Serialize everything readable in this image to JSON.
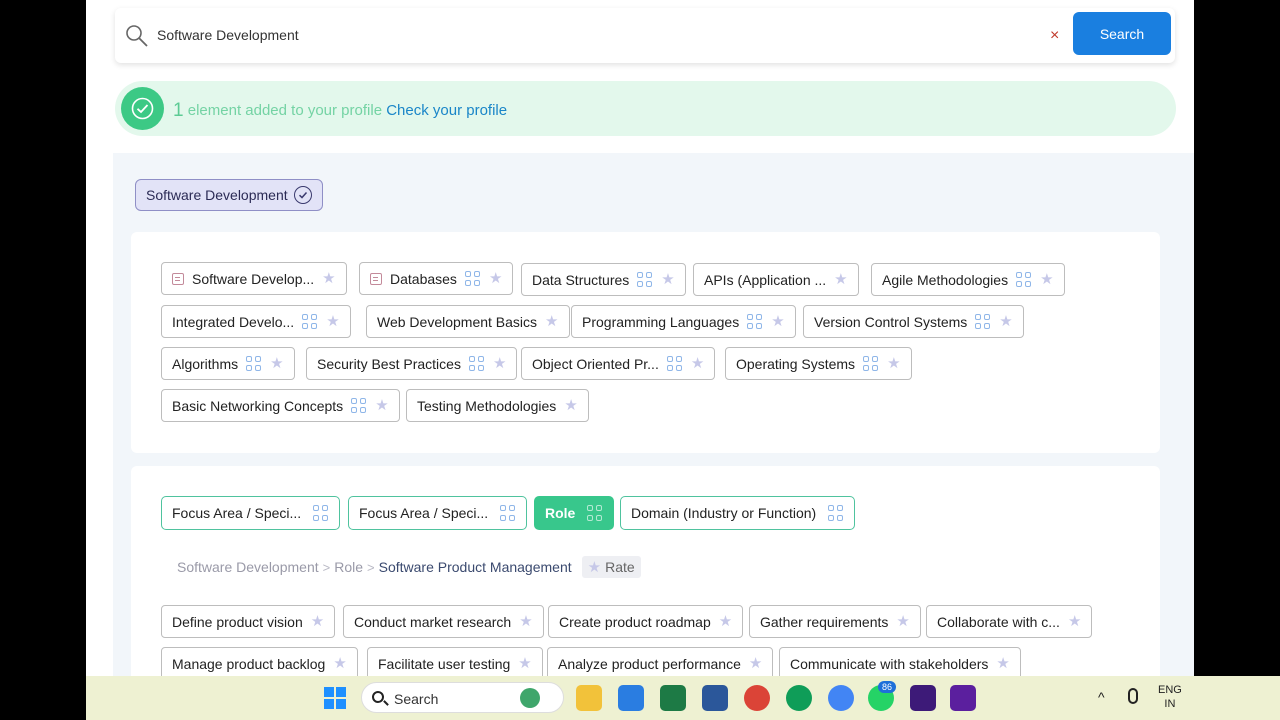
{
  "search": {
    "value": "Software Development",
    "clear_icon": "×",
    "button_label": "Search"
  },
  "banner": {
    "count": "1",
    "text": "element added to your profile",
    "link": "Check your profile"
  },
  "selected_chip": "Software Development",
  "topics": [
    "Software Develop...",
    "Databases",
    "Data Structures",
    "APIs (Application ...",
    "Agile Methodologies",
    "Integrated Develo...",
    "Web Development Basics",
    "Programming Languages",
    "Version Control Systems",
    "Algorithms",
    "Security Best Practices",
    "Object Oriented Pr...",
    "Operating Systems",
    "Basic Networking Concepts",
    "Testing Methodologies"
  ],
  "tabs": [
    "Focus Area / Speci...",
    "Focus Area / Speci...",
    "Role",
    "Domain (Industry or Function)"
  ],
  "active_tab": "Role",
  "breadcrumb": {
    "items": [
      "Software Development",
      "Role",
      "Software Product Management"
    ],
    "rate_label": "Rate"
  },
  "tasks": [
    "Define product vision",
    "Conduct market research",
    "Create product roadmap",
    "Gather requirements",
    "Collaborate with c...",
    "Manage product backlog",
    "Facilitate user testing",
    "Analyze product performance",
    "Communicate with stakeholders"
  ],
  "taskbar": {
    "search_label": "Search",
    "whatsapp_badge": "86",
    "lang_top": "ENG",
    "lang_bottom": "IN"
  },
  "colors": {
    "accent": "#1a7fe0",
    "success": "#3cc985",
    "active_tab": "#38c78c"
  }
}
